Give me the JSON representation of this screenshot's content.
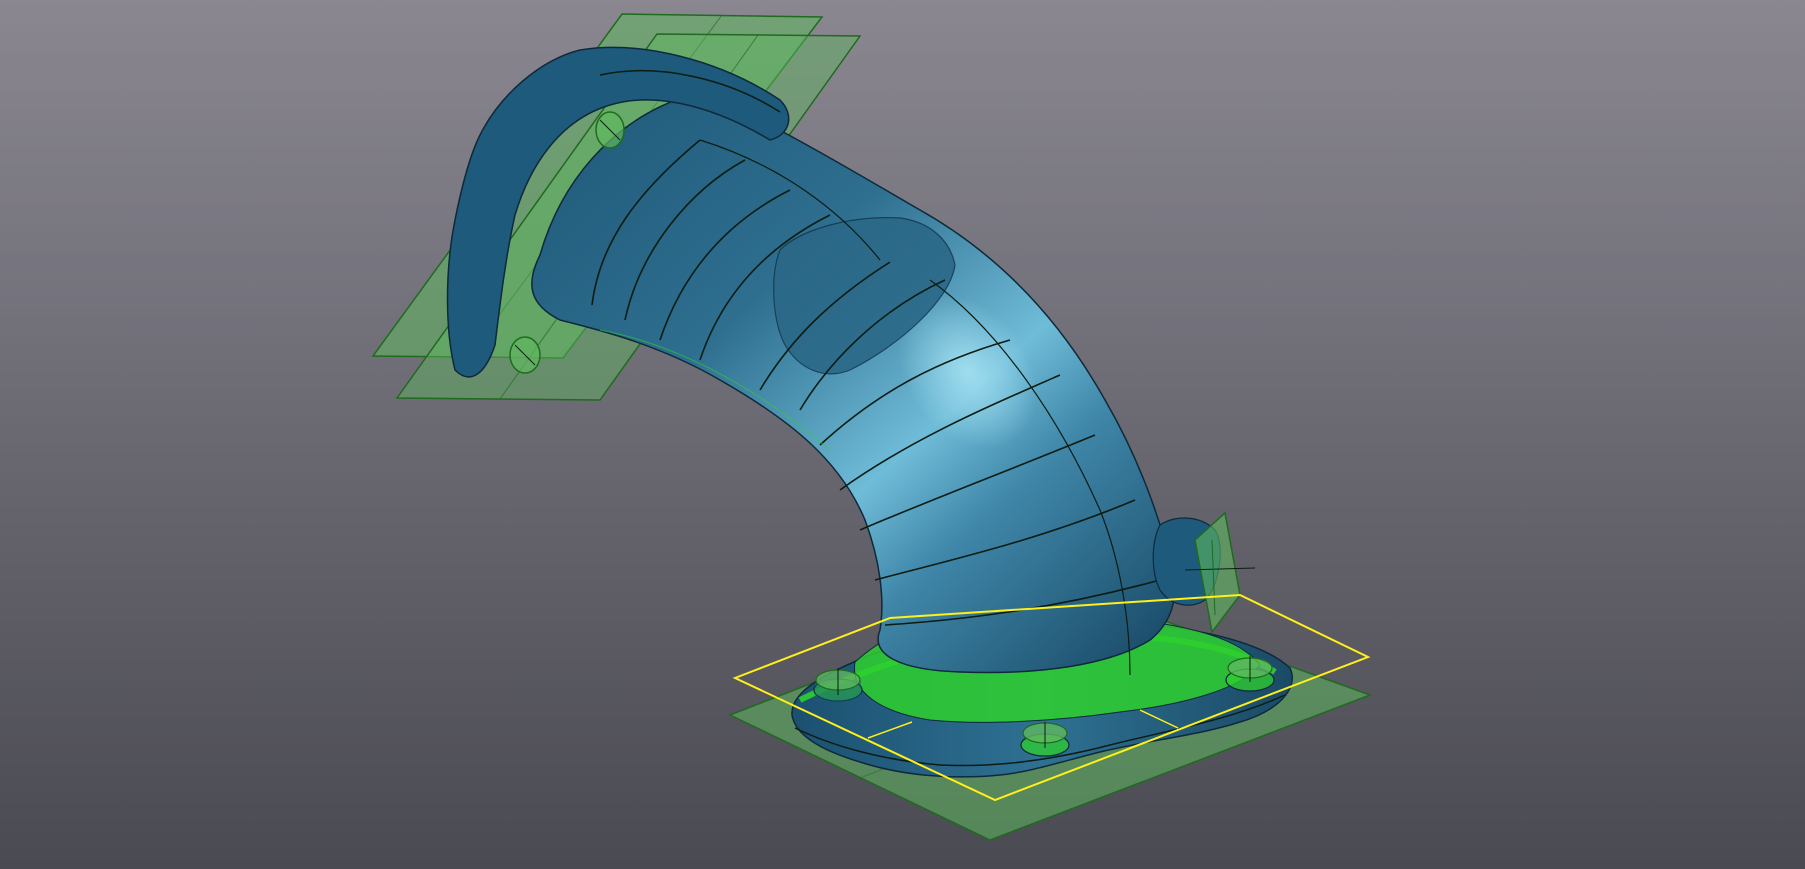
{
  "viewport": {
    "background_top": "#8a8791",
    "background_bottom": "#4a4a52"
  },
  "model": {
    "part_color": "#2e6e8f",
    "part_highlight": "#8fd3ea",
    "part_shadow": "#133a52",
    "section_line_color": "#0b1d12",
    "feature_color": "#2ed02e"
  },
  "datum_planes": {
    "plane_color": "#5fb85f",
    "plane_border": "#1f6b1f",
    "active_outline": "#ffef1a"
  }
}
